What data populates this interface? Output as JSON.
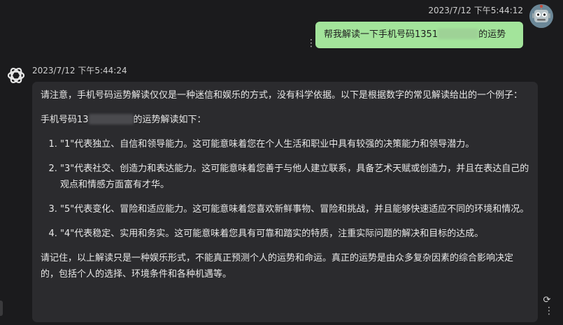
{
  "user_message": {
    "timestamp": "2023/7/12 下午5:44:12",
    "text_before": "帮我解读一下手机号码1351",
    "text_after": "的运势",
    "avatar_icon": "robot-avatar-icon",
    "menu_icon": "more-vertical-icon",
    "bubble_color": "#a3e49b"
  },
  "assistant_message": {
    "timestamp": "2023/7/12 下午5:44:24",
    "avatar_icon": "openai-logo-icon",
    "intro": "请注意，手机号码运势解读仅仅是一种迷信和娱乐的方式，没有科学依据。以下是根据数字的常见解读给出的一个例子：",
    "subhead_before": "手机号码13",
    "subhead_after": "的运势解读如下：",
    "items": [
      "\"1\"代表独立、自信和领导能力。这可能意味着您在个人生活和职业中具有较强的决策能力和领导潜力。",
      "\"3\"代表社交、创造力和表达能力。这可能意味着您善于与他人建立联系，具备艺术天赋或创造力，并且在表达自己的观点和情感方面富有才华。",
      "\"5\"代表变化、冒险和适应能力。这可能意味着您喜欢新鲜事物、冒险和挑战，并且能够快速适应不同的环境和情况。",
      "\"4\"代表稳定、实用和务实。这可能意味着您具有可靠和踏实的特质，注重实际问题的解决和目标的达成。"
    ],
    "closing": "请记住，以上解读只是一种娱乐形式，不能真正预测个人的运势和命运。真正的运势是由众多复杂因素的综合影响决定的，包括个人的选择、环境条件和各种机遇等。",
    "regenerate_icon": "regenerate-icon",
    "menu_icon": "more-vertical-icon"
  }
}
